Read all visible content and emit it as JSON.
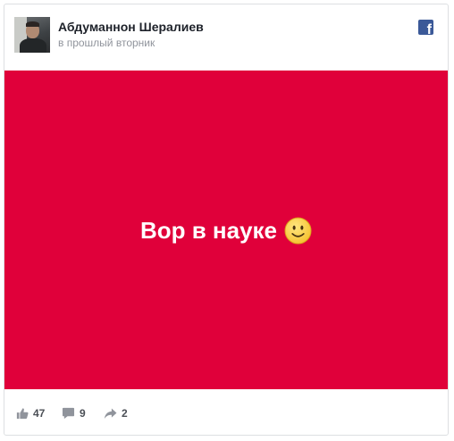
{
  "post": {
    "author": "Абдуманнон Шералиев",
    "time": "в прошлый вторник",
    "image_text": "Вор в науке",
    "emoji": "smiley-face-icon",
    "media_background": "#e0003a",
    "brand_color": "#3b5998"
  },
  "stats": {
    "likes": "47",
    "comments": "9",
    "shares": "2"
  },
  "icons": {
    "brand": "facebook-icon",
    "like": "thumbs-up-icon",
    "comment": "comment-icon",
    "share": "share-arrow-icon"
  }
}
